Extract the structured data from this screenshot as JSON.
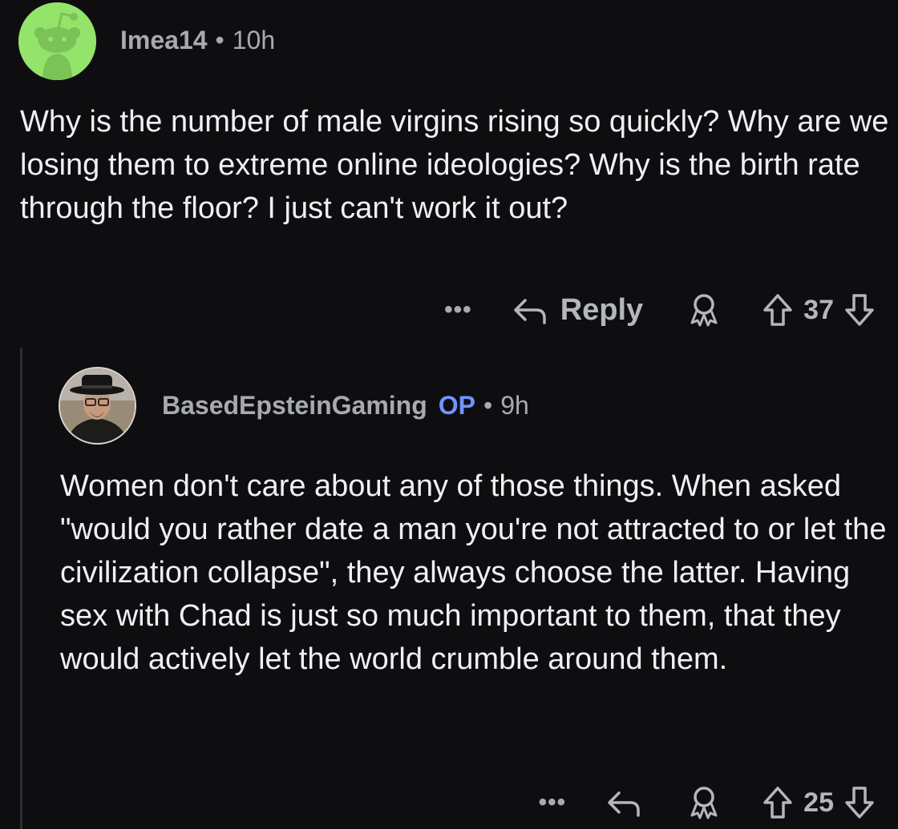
{
  "comments": [
    {
      "username": "Imea14",
      "separator": "•",
      "time": "10h",
      "avatar_icon": "reddit-snoo-icon",
      "text": "Why is the number of male virgins rising so quickly? Why are we losing them to extreme online ideologies? Why is the birth rate through the floor? I just can't work it out?",
      "more_label": "•••",
      "reply_label": "Reply",
      "votes": "37"
    },
    {
      "username": "BasedEpsteinGaming",
      "op_badge": "OP",
      "separator": "•",
      "time": "9h",
      "avatar_icon": "user-photo-avatar",
      "text": "Women don't care about any of those things. When asked \"would you rather date a man you're not attracted to or let the civilization collapse\", they always choose the latter. Having sex with Chad is just so much important to them, that they would actively let the world crumble around them.",
      "more_label": "•••",
      "votes": "25"
    }
  ],
  "colors": {
    "background": "#0e0e11",
    "text": "#eef0f2",
    "meta": "#a7aaae",
    "op_badge": "#7193ff",
    "avatar_green": "#94e36b"
  }
}
